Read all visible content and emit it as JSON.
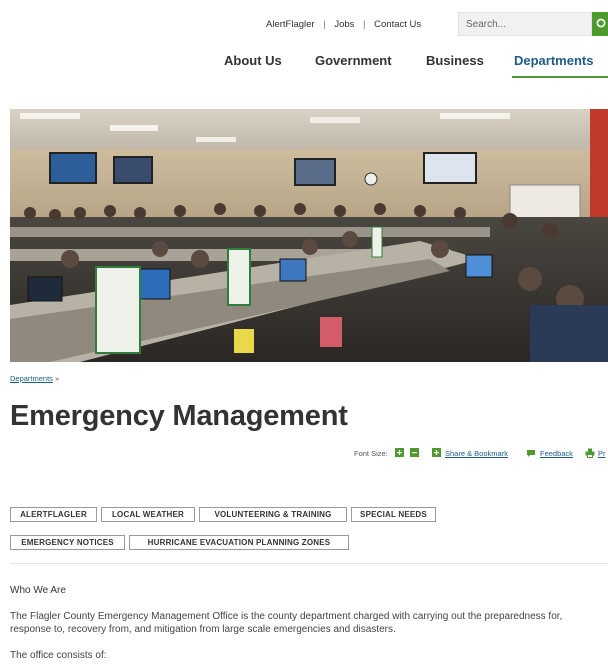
{
  "utility": {
    "links": [
      "AlertFlagler",
      "Jobs",
      "Contact Us"
    ],
    "separator": "|",
    "search_placeholder": "Search..."
  },
  "nav": {
    "items": [
      "About Us",
      "Government",
      "Business",
      "Departments"
    ],
    "active": "Departments"
  },
  "breadcrumb": {
    "parent": "Departments",
    "chevron": "»"
  },
  "page": {
    "title": "Emergency Management"
  },
  "tools": {
    "font_size_label": "Font Size:",
    "share_label": "Share & Bookmark",
    "feedback_label": "Feedback",
    "print_label": "Pr"
  },
  "tabs": {
    "row1": [
      "ALERTFLAGLER",
      "LOCAL WEATHER",
      "VOLUNTEERING & TRAINING",
      "SPECIAL NEEDS"
    ],
    "row2": [
      "EMERGENCY NOTICES",
      "HURRICANE EVACUATION PLANNING ZONES"
    ]
  },
  "content": {
    "heading": "Who We Are",
    "paragraph": "The Flagler County Emergency Management Office is the county department charged with carrying out the preparedness for, response to, recovery from, and mitigation from large scale emergencies and disasters.",
    "paragraph2": "The office consists of:"
  },
  "colors": {
    "accent_green": "#4f9a2f",
    "link_blue": "#1d5d8a",
    "text": "#333333"
  },
  "icons": [
    "search-icon",
    "plus-icon",
    "minus-icon",
    "share-icon",
    "feedback-icon",
    "print-icon"
  ]
}
